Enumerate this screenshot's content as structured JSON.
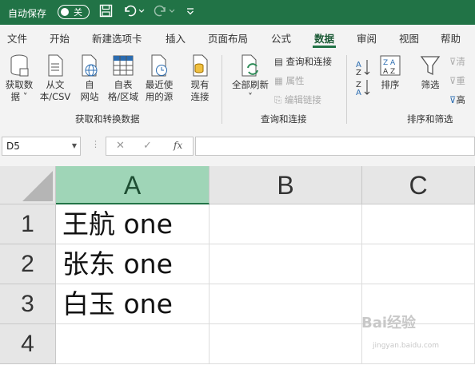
{
  "titlebar": {
    "autosave_label": "自动保存",
    "autosave_state": "关",
    "icons": [
      "save-icon",
      "undo-icon",
      "redo-icon",
      "customize-icon"
    ]
  },
  "tabs": [
    "文件",
    "开始",
    "新建选项卡",
    "插入",
    "页面布局",
    "公式",
    "数据",
    "审阅",
    "视图",
    "帮助"
  ],
  "active_tab": "数据",
  "ribbon": {
    "get_data": {
      "group_label": "获取和转换数据",
      "buttons": [
        {
          "line1": "获取数",
          "line2": "据 ˅"
        },
        {
          "line1": "从文",
          "line2": "本/CSV"
        },
        {
          "line1": "自",
          "line2": "网站"
        },
        {
          "line1": "自表",
          "line2": "格/区域"
        },
        {
          "line1": "最近使",
          "line2": "用的源"
        },
        {
          "line1": "现有",
          "line2": "连接"
        }
      ]
    },
    "queries": {
      "group_label": "查询和连接",
      "refresh_line1": "全部刷新",
      "refresh_line2": "˅",
      "queries_connections": "查询和连接",
      "properties": "属性",
      "edit_links": "编辑链接"
    },
    "sort": {
      "group_label": "排序和筛选",
      "sort": "排序",
      "filter": "筛选",
      "clear": "清",
      "reapply": "重",
      "advanced": "高"
    }
  },
  "formula_bar": {
    "name_box": "D5",
    "cancel": "✕",
    "enter": "✓",
    "fx": "fx",
    "content": ""
  },
  "grid": {
    "columns": [
      "A",
      "B",
      "C"
    ],
    "selected_column": "A",
    "rows": [
      "1",
      "2",
      "3",
      "4"
    ],
    "cells": [
      "王航 one",
      "张东 one",
      "白玉 one",
      ""
    ]
  },
  "watermark": {
    "text": "Bai经验",
    "url": "jingyan.baidu.com"
  },
  "colors": {
    "excel_green": "#217346",
    "selected_header": "#9fd5b7"
  }
}
